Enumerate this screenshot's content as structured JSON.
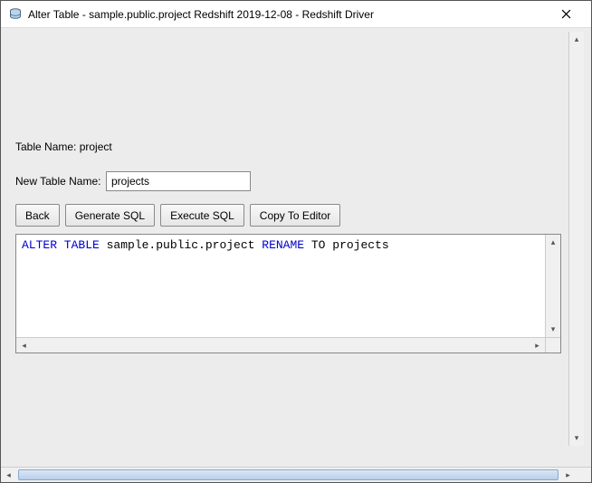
{
  "window": {
    "title": "Alter Table - sample.public.project Redshift 2019-12-08 - Redshift Driver"
  },
  "labels": {
    "table_name_label": "Table Name: project",
    "new_table_name_label": "New Table Name:"
  },
  "fields": {
    "new_table_name_value": "projects"
  },
  "buttons": {
    "back": "Back",
    "generate_sql": "Generate SQL",
    "execute_sql": "Execute SQL",
    "copy_to_editor": "Copy To Editor"
  },
  "sql": {
    "kw_alter_table": "ALTER TABLE",
    "obj": " sample.public.project ",
    "kw_rename": "RENAME",
    "mid": " TO projects"
  }
}
